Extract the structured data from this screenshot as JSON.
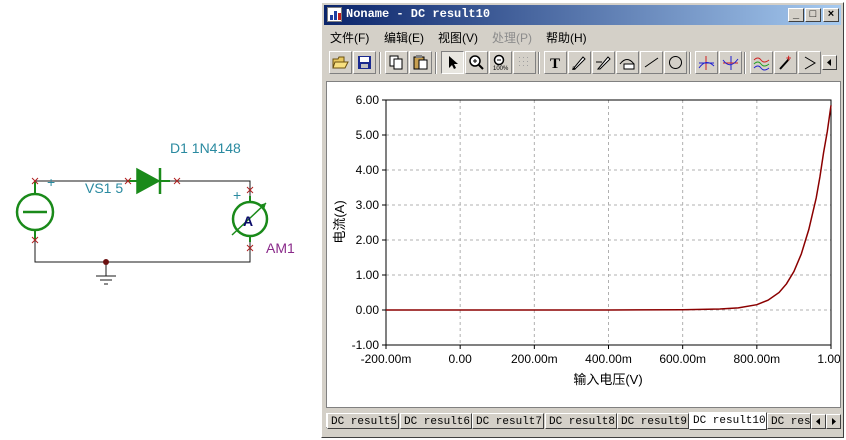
{
  "schematic": {
    "diode_label": "D1 1N4148",
    "source_label": "VS1 5",
    "ammeter_symbol": "A",
    "ammeter_label": "AM1",
    "plus_sign": "+",
    "colors": {
      "wire": "#1a1a1a",
      "component": "#1a8a1a",
      "label": "#2a8aa0",
      "ammeter_label": "#8a2a8a",
      "node": "#b02020"
    }
  },
  "window": {
    "title": "Noname - DC result10",
    "controls": {
      "minimize": "_",
      "maximize": "□",
      "close": "×"
    },
    "menu": [
      {
        "label": "文件(F)",
        "enabled": true
      },
      {
        "label": "编辑(E)",
        "enabled": true
      },
      {
        "label": "视图(V)",
        "enabled": true
      },
      {
        "label": "处理(P)",
        "enabled": false
      },
      {
        "label": "帮助(H)",
        "enabled": true
      }
    ],
    "toolbar_icons": [
      "open-folder-icon",
      "save-icon",
      "copy-icon",
      "paste-icon",
      "pointer-icon",
      "zoom-in-icon",
      "zoom-out-icon",
      "grid-icon",
      "text-tool-icon",
      "marker-icon",
      "marker2-icon",
      "curve-icon",
      "line-icon",
      "circle-icon",
      "cursor-a-icon",
      "cursor-b-icon",
      "signal-icon",
      "probe-icon",
      "flag-icon"
    ],
    "tabs": [
      "DC result5",
      "DC result6",
      "DC result7",
      "DC result8",
      "DC result9",
      "DC result10",
      "DC resu"
    ],
    "active_tab": "DC result10"
  },
  "chart_data": {
    "type": "line",
    "xlabel": "输入电压(V)",
    "ylabel": "电流(A)",
    "xlim": [
      -0.2,
      1.0
    ],
    "ylim": [
      -1.0,
      6.0
    ],
    "x_ticks": [
      "-200.00m",
      "0.00",
      "200.00m",
      "400.00m",
      "600.00m",
      "800.00m",
      "1.00"
    ],
    "y_ticks": [
      "6.00",
      "5.00",
      "4.00",
      "3.00",
      "2.00",
      "1.00",
      "0.00",
      "-1.00"
    ],
    "grid": true,
    "series": [
      {
        "color": "#8b0000",
        "x": [
          -0.2,
          0.0,
          0.2,
          0.4,
          0.6,
          0.7,
          0.75,
          0.8,
          0.83,
          0.86,
          0.88,
          0.9,
          0.92,
          0.94,
          0.96,
          0.97,
          0.98,
          0.99,
          1.0
        ],
        "y": [
          0,
          0,
          0,
          0,
          0.01,
          0.03,
          0.06,
          0.15,
          0.28,
          0.5,
          0.75,
          1.1,
          1.6,
          2.3,
          3.2,
          3.8,
          4.5,
          5.1,
          5.85
        ]
      }
    ]
  }
}
